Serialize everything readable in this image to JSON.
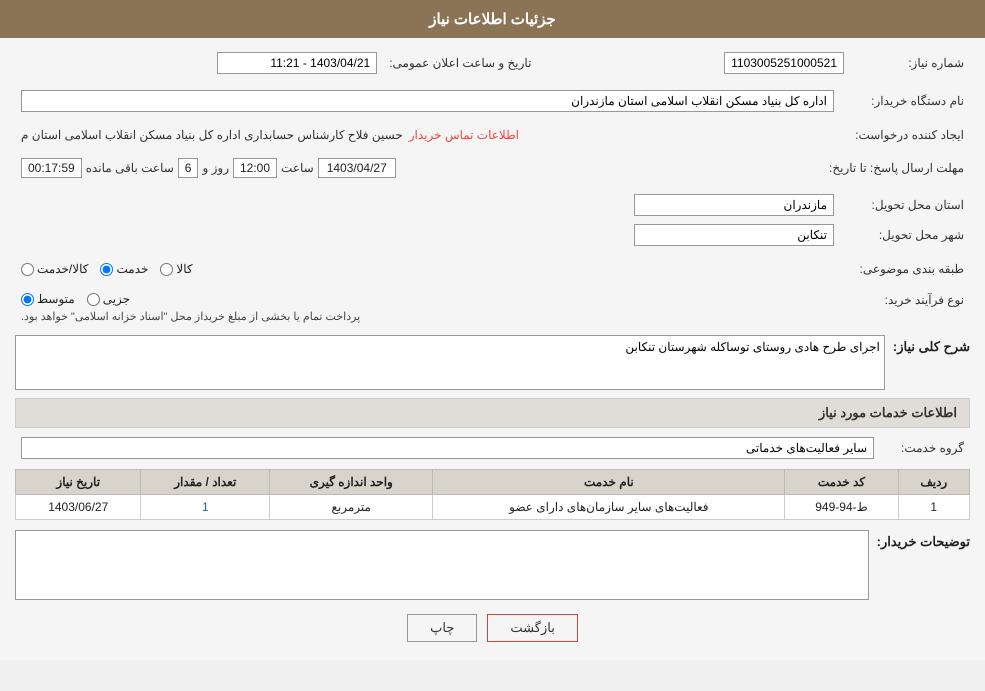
{
  "header": {
    "title": "جزئیات اطلاعات نیاز"
  },
  "fields": {
    "need_number_label": "شماره نیاز:",
    "need_number_value": "1103005251000521",
    "announce_datetime_label": "تاریخ و ساعت اعلان عمومی:",
    "announce_datetime_value": "1403/04/21 - 11:21",
    "buyer_org_label": "نام دستگاه خریدار:",
    "buyer_org_value": "اداره کل بنیاد مسکن انقلاب اسلامی استان مازندران",
    "creator_label": "ایجاد کننده درخواست:",
    "creator_value": "حسین فلاح کارشناس حسابداری اداره کل بنیاد مسکن انقلاب اسلامی استان م",
    "creator_link": "اطلاعات تماس خریدار",
    "deadline_label": "مهلت ارسال پاسخ: تا تاریخ:",
    "deadline_date": "1403/04/27",
    "deadline_time_label": "ساعت",
    "deadline_time": "12:00",
    "deadline_day_label": "روز و",
    "deadline_days": "6",
    "deadline_remaining_label": "ساعت باقی مانده",
    "deadline_remaining": "00:17:59",
    "delivery_province_label": "استان محل تحویل:",
    "delivery_province_value": "مازندران",
    "delivery_city_label": "شهر محل تحویل:",
    "delivery_city_value": "تنکابن",
    "subject_label": "طبقه بندی موضوعی:",
    "subject_options": [
      "کالا",
      "خدمت",
      "کالا/خدمت"
    ],
    "subject_selected": "خدمت",
    "purchase_type_label": "نوع فرآیند خرید:",
    "purchase_type_options": [
      "جزیی",
      "متوسط"
    ],
    "purchase_type_selected": "متوسط",
    "purchase_type_note": "پرداخت تمام یا بخشی از مبلغ خریداز محل \"اسناد خزانه اسلامی\" خواهد بود.",
    "need_desc_label": "شرح کلی نیاز:",
    "need_desc_value": "اجرای طرح هادی روستای توساکله شهرستان تنکابن",
    "services_header": "اطلاعات خدمات مورد نیاز",
    "service_group_label": "گروه خدمت:",
    "service_group_value": "سایر فعالیت‌های خدماتی",
    "table": {
      "columns": [
        "ردیف",
        "کد خدمت",
        "نام خدمت",
        "واحد اندازه گیری",
        "تعداد / مقدار",
        "تاریخ نیاز"
      ],
      "rows": [
        {
          "row_num": "1",
          "service_code": "ط-94-949",
          "service_name": "فعالیت‌های سایر سازمان‌های دارای عضو",
          "unit": "مترمربع",
          "quantity": "1",
          "date": "1403/06/27"
        }
      ]
    },
    "buyer_notes_label": "توضیحات خریدار:",
    "buyer_notes_value": ""
  },
  "buttons": {
    "print_label": "چاپ",
    "back_label": "بازگشت"
  }
}
